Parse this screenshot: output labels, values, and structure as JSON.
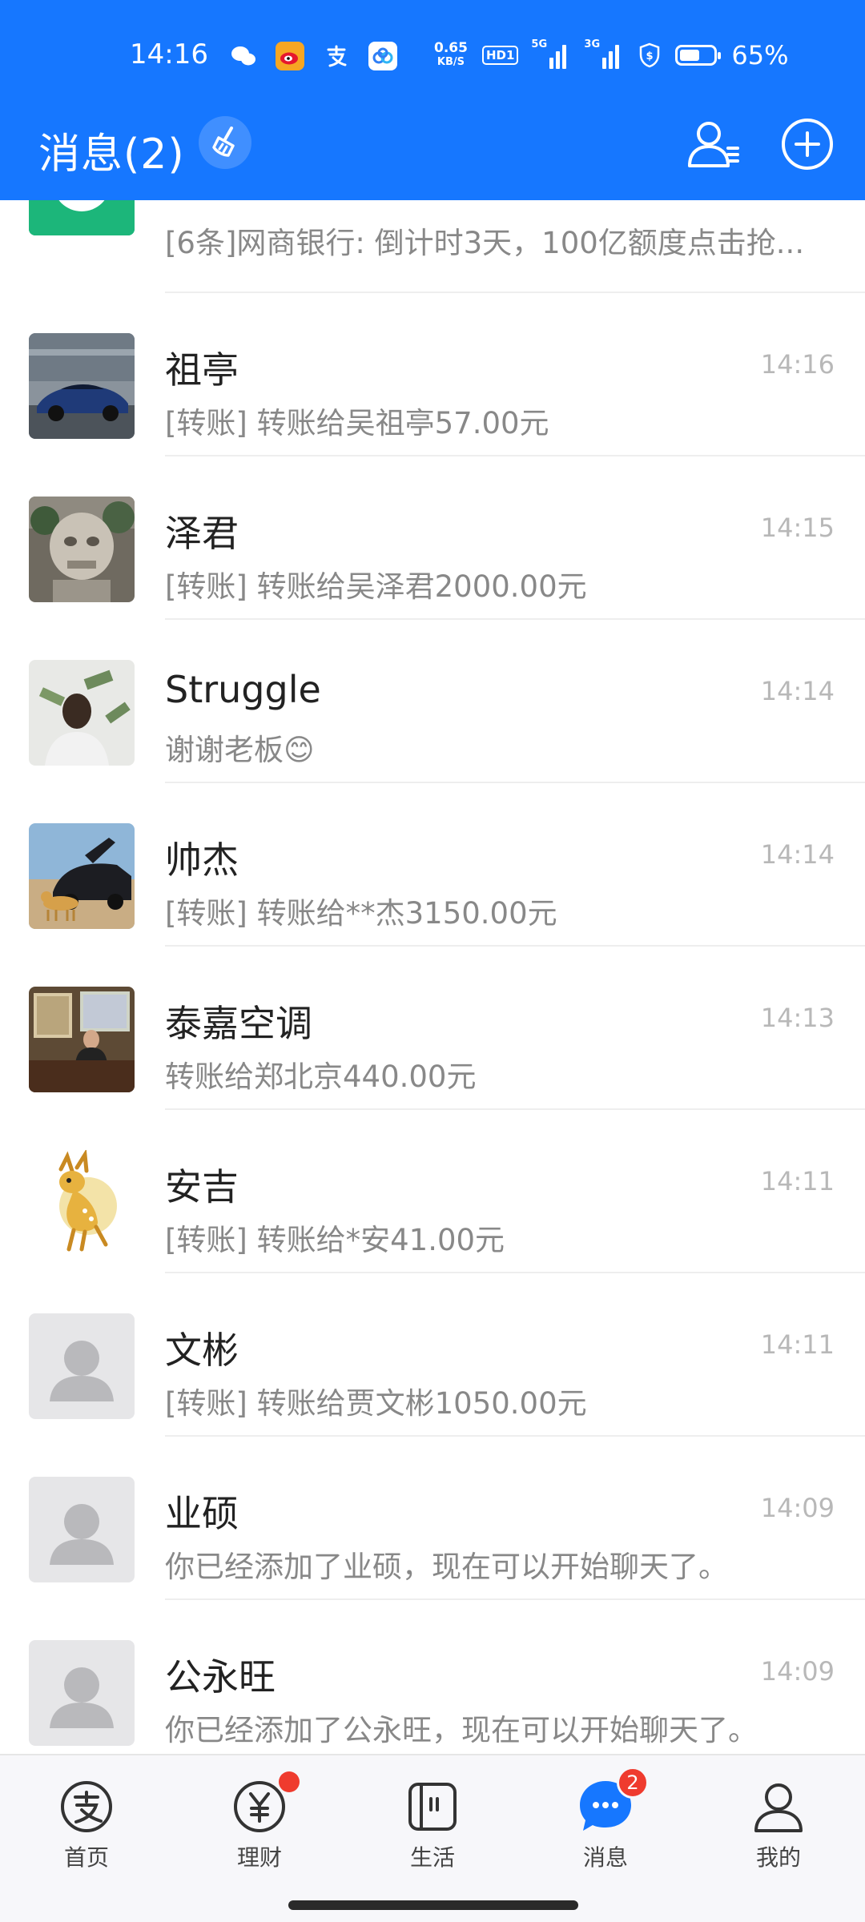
{
  "status_bar": {
    "time": "14:16",
    "net_speed_value": "0.65",
    "net_speed_unit": "KB/S",
    "hd_badge": "HD1",
    "signal_1_tag": "5G",
    "signal_2_tag": "3G",
    "battery_percent": "65%",
    "battery_level": 0.65
  },
  "header": {
    "title": "消息(2)",
    "color": "#1677ff"
  },
  "conversations": [
    {
      "name": "",
      "preview": "[6条]网商银行: 倒计时3天，100亿额度点击抢...",
      "time": ""
    },
    {
      "name": "祖亭",
      "preview": "[转账] 转账给吴祖亭57.00元",
      "time": "14:16"
    },
    {
      "name": "泽君",
      "preview": "[转账] 转账给吴泽君2000.00元",
      "time": "14:15"
    },
    {
      "name": "Struggle",
      "preview": "谢谢老板😊",
      "time": "14:14"
    },
    {
      "name": "帅杰",
      "preview": "[转账] 转账给**杰3150.00元",
      "time": "14:14"
    },
    {
      "name": "泰嘉空调",
      "preview": "转账给郑北京440.00元",
      "time": "14:13"
    },
    {
      "name": "安吉",
      "preview": "[转账] 转账给*安41.00元",
      "time": "14:11"
    },
    {
      "name": "文彬",
      "preview": "[转账] 转账给贾文彬1050.00元",
      "time": "14:11"
    },
    {
      "name": "业硕",
      "preview": "你已经添加了业硕，现在可以开始聊天了。",
      "time": "14:09"
    },
    {
      "name": "公永旺",
      "preview": "你已经添加了公永旺，现在可以开始聊天了。",
      "time": "14:09"
    }
  ],
  "tabbar": {
    "tabs": [
      {
        "label": "首页",
        "icon": "alipay-icon"
      },
      {
        "label": "理财",
        "icon": "yen-icon"
      },
      {
        "label": "生活",
        "icon": "life-icon"
      },
      {
        "label": "消息",
        "icon": "chat-bubble-icon",
        "badge": "2"
      },
      {
        "label": "我的",
        "icon": "person-icon"
      }
    ]
  }
}
